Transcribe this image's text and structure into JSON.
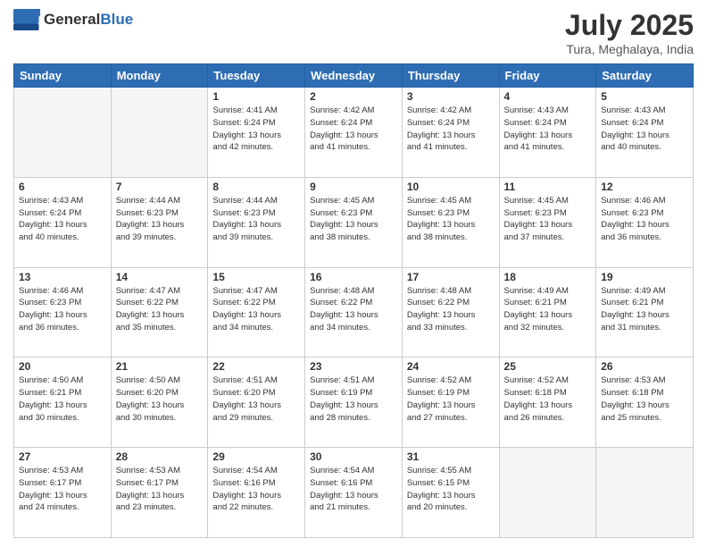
{
  "header": {
    "logo_general": "General",
    "logo_blue": "Blue",
    "title": "July 2025",
    "subtitle": "Tura, Meghalaya, India"
  },
  "days_of_week": [
    "Sunday",
    "Monday",
    "Tuesday",
    "Wednesday",
    "Thursday",
    "Friday",
    "Saturday"
  ],
  "weeks": [
    [
      {
        "day": "",
        "info": ""
      },
      {
        "day": "",
        "info": ""
      },
      {
        "day": "1",
        "sunrise": "4:41 AM",
        "sunset": "6:24 PM",
        "daylight": "13 hours and 42 minutes."
      },
      {
        "day": "2",
        "sunrise": "4:42 AM",
        "sunset": "6:24 PM",
        "daylight": "13 hours and 41 minutes."
      },
      {
        "day": "3",
        "sunrise": "4:42 AM",
        "sunset": "6:24 PM",
        "daylight": "13 hours and 41 minutes."
      },
      {
        "day": "4",
        "sunrise": "4:43 AM",
        "sunset": "6:24 PM",
        "daylight": "13 hours and 41 minutes."
      },
      {
        "day": "5",
        "sunrise": "4:43 AM",
        "sunset": "6:24 PM",
        "daylight": "13 hours and 40 minutes."
      }
    ],
    [
      {
        "day": "6",
        "sunrise": "4:43 AM",
        "sunset": "6:24 PM",
        "daylight": "13 hours and 40 minutes."
      },
      {
        "day": "7",
        "sunrise": "4:44 AM",
        "sunset": "6:23 PM",
        "daylight": "13 hours and 39 minutes."
      },
      {
        "day": "8",
        "sunrise": "4:44 AM",
        "sunset": "6:23 PM",
        "daylight": "13 hours and 39 minutes."
      },
      {
        "day": "9",
        "sunrise": "4:45 AM",
        "sunset": "6:23 PM",
        "daylight": "13 hours and 38 minutes."
      },
      {
        "day": "10",
        "sunrise": "4:45 AM",
        "sunset": "6:23 PM",
        "daylight": "13 hours and 38 minutes."
      },
      {
        "day": "11",
        "sunrise": "4:45 AM",
        "sunset": "6:23 PM",
        "daylight": "13 hours and 37 minutes."
      },
      {
        "day": "12",
        "sunrise": "4:46 AM",
        "sunset": "6:23 PM",
        "daylight": "13 hours and 36 minutes."
      }
    ],
    [
      {
        "day": "13",
        "sunrise": "4:46 AM",
        "sunset": "6:23 PM",
        "daylight": "13 hours and 36 minutes."
      },
      {
        "day": "14",
        "sunrise": "4:47 AM",
        "sunset": "6:22 PM",
        "daylight": "13 hours and 35 minutes."
      },
      {
        "day": "15",
        "sunrise": "4:47 AM",
        "sunset": "6:22 PM",
        "daylight": "13 hours and 34 minutes."
      },
      {
        "day": "16",
        "sunrise": "4:48 AM",
        "sunset": "6:22 PM",
        "daylight": "13 hours and 34 minutes."
      },
      {
        "day": "17",
        "sunrise": "4:48 AM",
        "sunset": "6:22 PM",
        "daylight": "13 hours and 33 minutes."
      },
      {
        "day": "18",
        "sunrise": "4:49 AM",
        "sunset": "6:21 PM",
        "daylight": "13 hours and 32 minutes."
      },
      {
        "day": "19",
        "sunrise": "4:49 AM",
        "sunset": "6:21 PM",
        "daylight": "13 hours and 31 minutes."
      }
    ],
    [
      {
        "day": "20",
        "sunrise": "4:50 AM",
        "sunset": "6:21 PM",
        "daylight": "13 hours and 30 minutes."
      },
      {
        "day": "21",
        "sunrise": "4:50 AM",
        "sunset": "6:20 PM",
        "daylight": "13 hours and 30 minutes."
      },
      {
        "day": "22",
        "sunrise": "4:51 AM",
        "sunset": "6:20 PM",
        "daylight": "13 hours and 29 minutes."
      },
      {
        "day": "23",
        "sunrise": "4:51 AM",
        "sunset": "6:19 PM",
        "daylight": "13 hours and 28 minutes."
      },
      {
        "day": "24",
        "sunrise": "4:52 AM",
        "sunset": "6:19 PM",
        "daylight": "13 hours and 27 minutes."
      },
      {
        "day": "25",
        "sunrise": "4:52 AM",
        "sunset": "6:18 PM",
        "daylight": "13 hours and 26 minutes."
      },
      {
        "day": "26",
        "sunrise": "4:53 AM",
        "sunset": "6:18 PM",
        "daylight": "13 hours and 25 minutes."
      }
    ],
    [
      {
        "day": "27",
        "sunrise": "4:53 AM",
        "sunset": "6:17 PM",
        "daylight": "13 hours and 24 minutes."
      },
      {
        "day": "28",
        "sunrise": "4:53 AM",
        "sunset": "6:17 PM",
        "daylight": "13 hours and 23 minutes."
      },
      {
        "day": "29",
        "sunrise": "4:54 AM",
        "sunset": "6:16 PM",
        "daylight": "13 hours and 22 minutes."
      },
      {
        "day": "30",
        "sunrise": "4:54 AM",
        "sunset": "6:16 PM",
        "daylight": "13 hours and 21 minutes."
      },
      {
        "day": "31",
        "sunrise": "4:55 AM",
        "sunset": "6:15 PM",
        "daylight": "13 hours and 20 minutes."
      },
      {
        "day": "",
        "info": ""
      },
      {
        "day": "",
        "info": ""
      }
    ]
  ],
  "labels": {
    "sunrise": "Sunrise:",
    "sunset": "Sunset:",
    "daylight": "Daylight:"
  }
}
